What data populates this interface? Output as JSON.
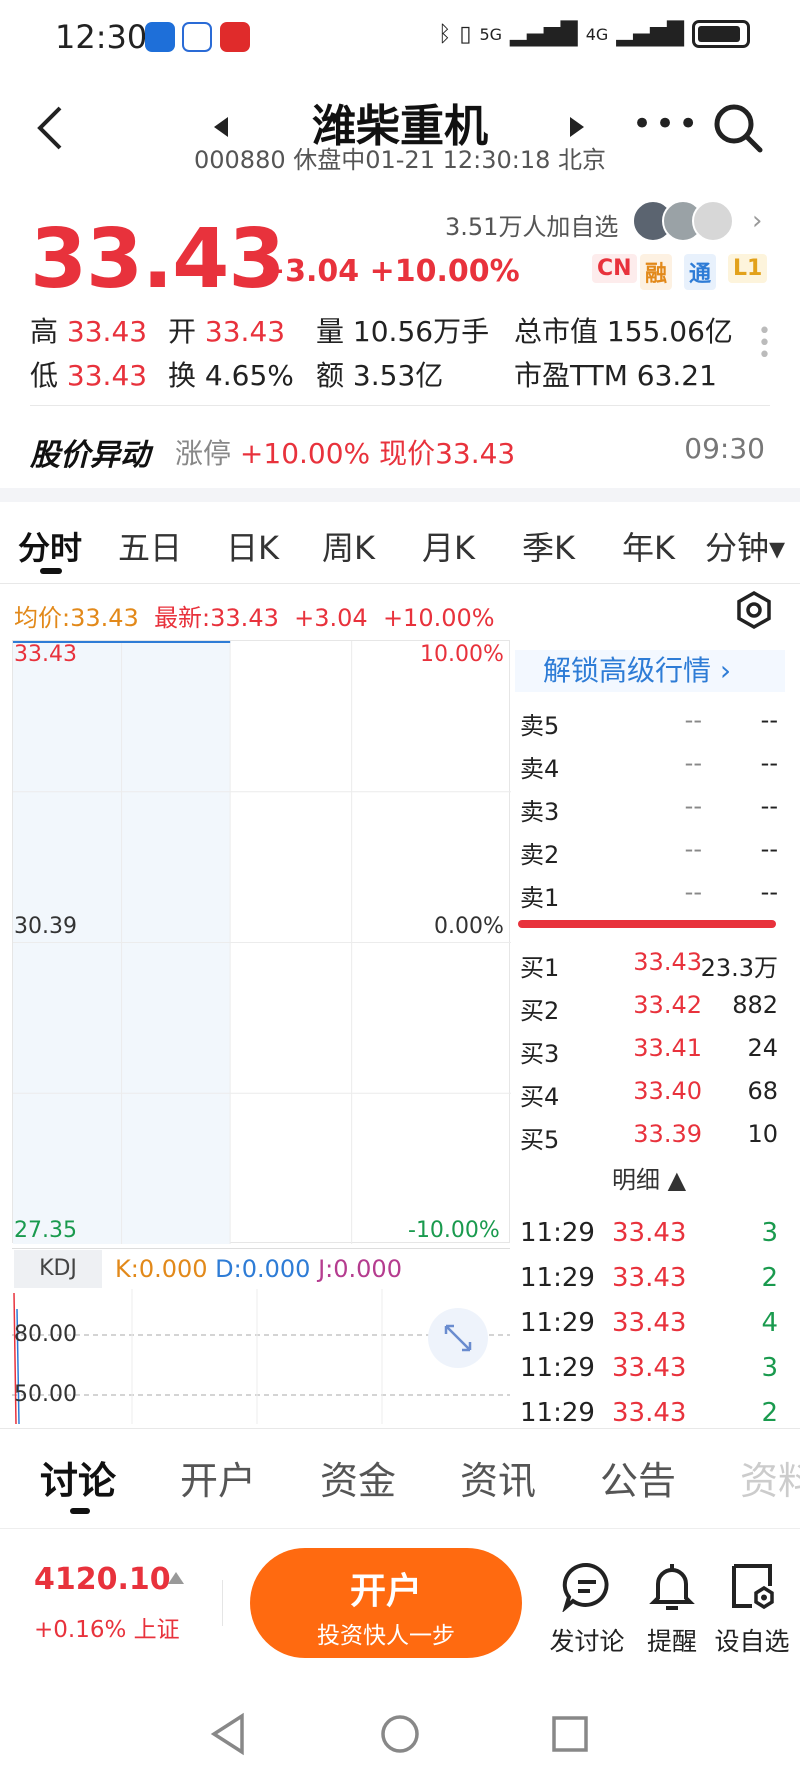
{
  "status_bar": {
    "time": "12:30",
    "signals": "5G",
    "signals2": "4G"
  },
  "header": {
    "title": "潍柴重机",
    "subtitle": "000880 休盘中01-21 12:30:18 北京"
  },
  "quote": {
    "price": "33.43",
    "change": "+3.04",
    "change_pct": "+10.00%",
    "followers": "3.51万人加自选",
    "badges": [
      "CN",
      "融",
      "通",
      "L1"
    ],
    "stats": {
      "high_label": "高",
      "high": "33.43",
      "open_label": "开",
      "open": "33.43",
      "vol_label": "量",
      "vol": "10.56万手",
      "mcap_label": "总市值",
      "mcap": "155.06亿",
      "low_label": "低",
      "low": "33.43",
      "turn_label": "换",
      "turn": "4.65%",
      "amt_label": "额",
      "amt": "3.53亿",
      "pe_label": "市盈TTM",
      "pe": "63.21"
    }
  },
  "anomaly": {
    "title": "股价异动",
    "label": "涨停",
    "pct": "+10.00%",
    "now": "现价33.43",
    "time": "09:30"
  },
  "period_tabs": [
    "分时",
    "五日",
    "日K",
    "周K",
    "月K",
    "季K",
    "年K",
    "分钟▾"
  ],
  "intraday": {
    "avg": "均价:33.43",
    "latest": "最新:33.43",
    "chg": "+3.04",
    "pct": "+10.00%"
  },
  "chart_data": {
    "type": "line",
    "title": "",
    "y_left_ticks": [
      "33.43",
      "30.39",
      "27.35"
    ],
    "y_right_ticks": [
      "10.00%",
      "0.00%",
      "-10.00%"
    ],
    "ylim": [
      27.35,
      33.43
    ],
    "x": [],
    "series": [
      {
        "values": [
          33.43
        ]
      }
    ]
  },
  "kdj": {
    "tag": "KDJ",
    "k": "K:0.000",
    "d": "D:0.000",
    "j": "J:0.000",
    "levels": [
      "80.00",
      "50.00"
    ]
  },
  "orderbook": {
    "unlock": "解锁高级行情 ›",
    "sells": [
      {
        "label": "卖5",
        "price": "--",
        "vol": "--"
      },
      {
        "label": "卖4",
        "price": "--",
        "vol": "--"
      },
      {
        "label": "卖3",
        "price": "--",
        "vol": "--"
      },
      {
        "label": "卖2",
        "price": "--",
        "vol": "--"
      },
      {
        "label": "卖1",
        "price": "--",
        "vol": "--"
      }
    ],
    "buys": [
      {
        "label": "买1",
        "price": "33.43",
        "vol": "23.3万"
      },
      {
        "label": "买2",
        "price": "33.42",
        "vol": "882"
      },
      {
        "label": "买3",
        "price": "33.41",
        "vol": "24"
      },
      {
        "label": "买4",
        "price": "33.40",
        "vol": "68"
      },
      {
        "label": "买5",
        "price": "33.39",
        "vol": "10"
      }
    ],
    "detail_label": "明细 ▲",
    "ticks": [
      {
        "time": "11:29",
        "price": "33.43",
        "vol": "3"
      },
      {
        "time": "11:29",
        "price": "33.43",
        "vol": "2"
      },
      {
        "time": "11:29",
        "price": "33.43",
        "vol": "4"
      },
      {
        "time": "11:29",
        "price": "33.43",
        "vol": "3"
      },
      {
        "time": "11:29",
        "price": "33.43",
        "vol": "2"
      }
    ]
  },
  "news_tabs": [
    "讨论",
    "开户",
    "资金",
    "资讯",
    "公告",
    "资料"
  ],
  "bottom": {
    "index_value": "4120.10",
    "index_chg": "+0.16% 上证",
    "open_main": "开户",
    "open_sub": "投资快人一步",
    "tools": [
      "发讨论",
      "提醒",
      "设自选"
    ]
  },
  "colors": {
    "up": "#e8323c",
    "down": "#1a9a4e",
    "accent": "#ff6a10",
    "link": "#2e7cd6"
  }
}
